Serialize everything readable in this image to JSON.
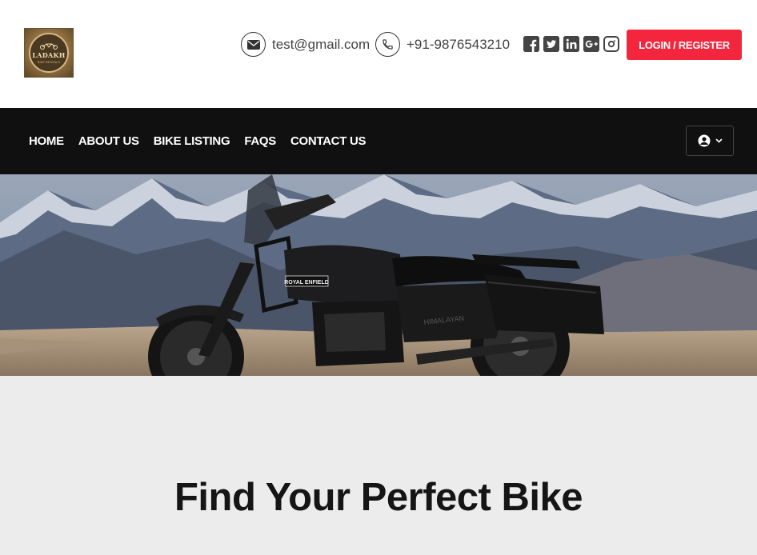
{
  "logo": {
    "alt": "Ladakh Bike Rental logo",
    "text": "LADAKH",
    "subtext": "BIKE RENTALS"
  },
  "header": {
    "email": "test@gmail.com",
    "phone": "+91-9876543210",
    "socials": [
      {
        "icon": "facebook-icon"
      },
      {
        "icon": "twitter-icon"
      },
      {
        "icon": "linkedin-icon"
      },
      {
        "icon": "google-plus-icon"
      },
      {
        "icon": "instagram-icon"
      }
    ],
    "login_label": "LOGIN / REGISTER"
  },
  "nav": {
    "items": [
      "HOME",
      "ABOUT US",
      "BIKE LISTING",
      "FAQS",
      "CONTACT US"
    ]
  },
  "hero": {
    "tank_badge": "ROYAL ENFIELD",
    "side_label": "HIMALAYAN"
  },
  "find": {
    "title": "Find Your Perfect Bike",
    "text": ""
  },
  "colors": {
    "accent": "#f4263e",
    "nav_bg": "#101010",
    "section_bg": "#ececec"
  }
}
